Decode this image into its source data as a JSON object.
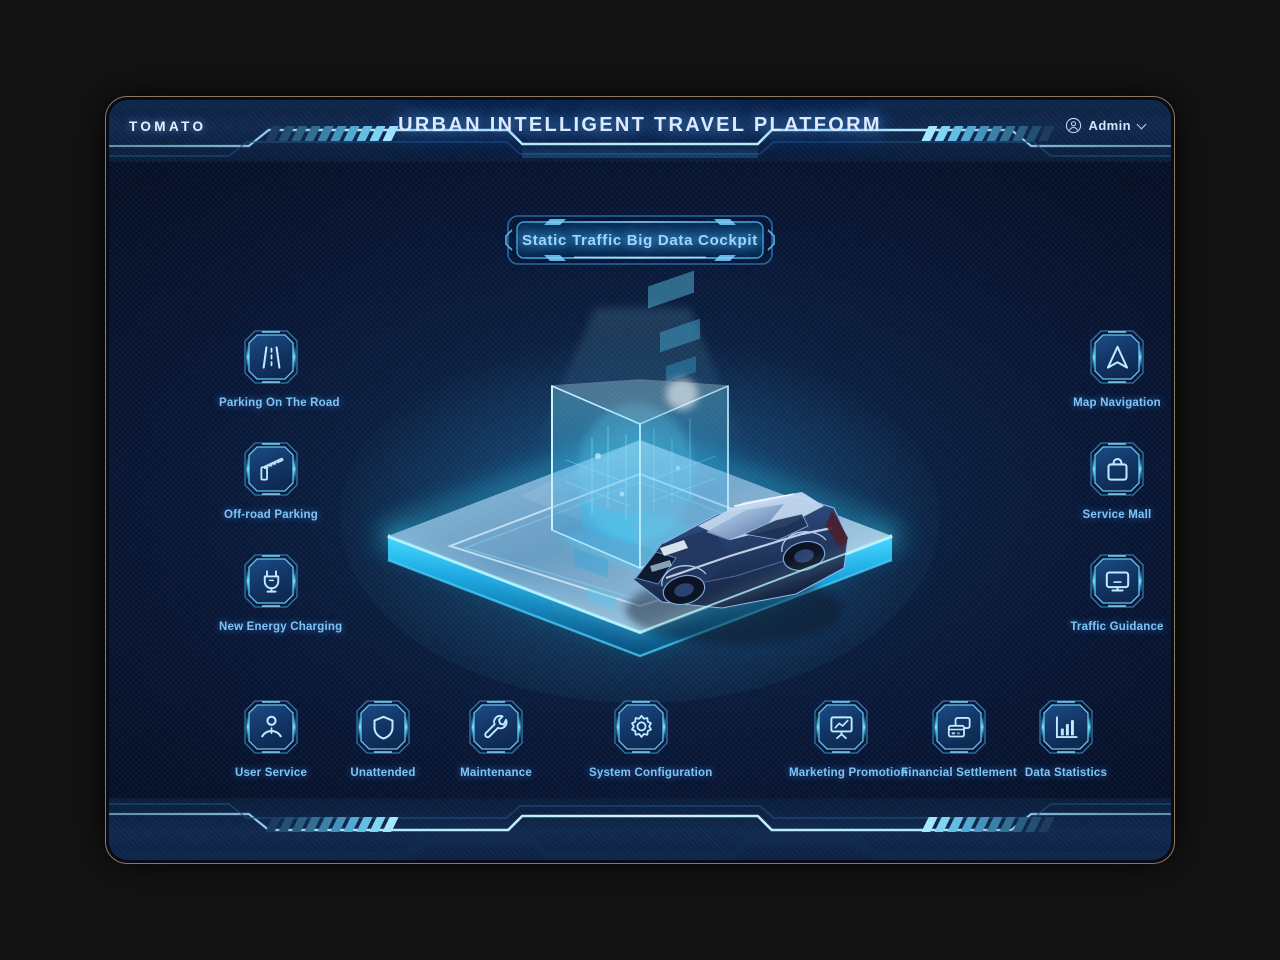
{
  "brand": {
    "logo": "TOMATO"
  },
  "header": {
    "title": "URBAN INTELLIGENT TRAVEL PLATFORM",
    "user": {
      "name": "Admin",
      "avatar_icon": "user-circle-icon",
      "dropdown_icon": "chevron-down-icon"
    }
  },
  "cockpit": {
    "title": "Static Traffic Big Data Cockpit"
  },
  "scene": {
    "description": "Isometric glowing platform with holographic data cube and blue SUV",
    "platform_glow": "#2fd8ff",
    "car_color": "#1b2d55"
  },
  "menu": {
    "left": [
      {
        "label": "Parking On The Road",
        "icon": "road-lane-icon"
      },
      {
        "label": "Off-road Parking",
        "icon": "barrier-gate-icon"
      },
      {
        "label": "New Energy Charging",
        "icon": "power-plug-icon"
      }
    ],
    "right": [
      {
        "label": "Map Navigation",
        "icon": "navigation-arrow-icon"
      },
      {
        "label": "Service Mall",
        "icon": "shopping-bag-icon"
      },
      {
        "label": "Traffic Guidance",
        "icon": "monitor-screen-icon"
      }
    ],
    "bottom": [
      {
        "label": "User Service",
        "icon": "person-service-icon"
      },
      {
        "label": "Unattended",
        "icon": "shield-icon"
      },
      {
        "label": "Maintenance",
        "icon": "wrench-icon"
      },
      {
        "label": "System Configuration",
        "icon": "gear-icon"
      },
      {
        "label": "Marketing Promotion",
        "icon": "presentation-chart-icon"
      },
      {
        "label": "Financial Settlement",
        "icon": "credit-card-icon"
      },
      {
        "label": "Data Statistics",
        "icon": "bar-chart-icon"
      }
    ]
  },
  "theme": {
    "accent_cyan": "#35d6ff",
    "accent_blue": "#2f7fd8",
    "label_blue": "#7fc3f5",
    "bg_dark": "#060f24",
    "frame_bronze": "#8c7a5e"
  }
}
